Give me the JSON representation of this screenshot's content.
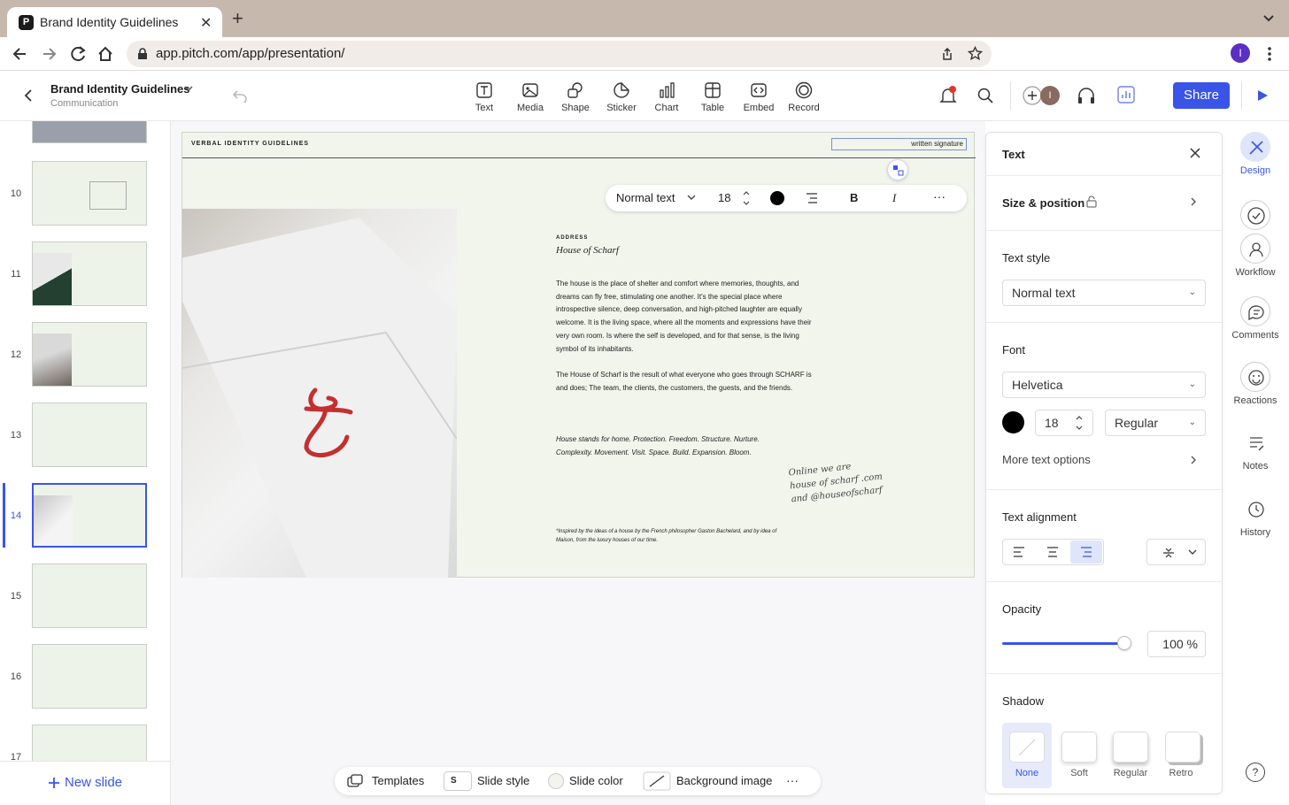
{
  "browser": {
    "tab_title": "Brand Identity Guidelines",
    "favicon_letter": "P",
    "url": "app.pitch.com/app/presentation/",
    "profile_initial": "I"
  },
  "header": {
    "doc_title": "Brand Identity Guidelines",
    "doc_subtitle": "Communication",
    "tools": [
      "Text",
      "Media",
      "Shape",
      "Sticker",
      "Chart",
      "Table",
      "Embed",
      "Record"
    ],
    "share_label": "Share",
    "avatar_initial": "I",
    "accent": "#3a54e8"
  },
  "slides": {
    "numbers": [
      "10",
      "11",
      "12",
      "13",
      "14",
      "15",
      "16",
      "17"
    ],
    "selected": "14",
    "new_slide_label": "New slide"
  },
  "slide": {
    "header": "VERBAL IDENTITY GUIDELINES",
    "signature_box": "written signature",
    "address_label": "ADDRESS",
    "address_name": "House of Scharf",
    "paragraph1": "The house is the place of shelter and comfort where memories, thoughts, and dreams can fly free, stimulating one another. It's the special place where introspective silence, deep conversation, and high-pitched laughter are equally welcome. It is the living space, where all the moments and expressions have their very own room. Is where the self is developed, and for that sense, is the living symbol of its inhabitants.",
    "paragraph2": "The House of Scharf is the result of what everyone who goes through SCHARF is and does; The team, the clients, the customers, the guests, and the friends.",
    "paragraph3": "House stands for home. Protection. Freedom. Structure. Nurture. Complexity. Movement. Visit. Space. Build. Expansion. Bloom.",
    "handwriting": [
      "Online we are",
      "house of scharf .com",
      "and @houseofscharf"
    ],
    "footnote": "*Inspired by the ideas of a house by the French philosopher Gaston Bachelard, and by idea of Maison, from the luxury houses of our time."
  },
  "format_bar": {
    "style": "Normal text",
    "size": "18",
    "bold": "B",
    "italic": "I",
    "more": "···"
  },
  "bottom_bar": {
    "templates": "Templates",
    "slide_style": "Slide style",
    "slide_style_icon": "S",
    "slide_color": "Slide color",
    "background_image": "Background image",
    "more": "···"
  },
  "panel": {
    "title": "Text",
    "size_position": "Size & position",
    "text_style_label": "Text style",
    "text_style_value": "Normal text",
    "font_label": "Font",
    "font_value": "Helvetica",
    "font_size": "18",
    "font_weight": "Regular",
    "more_text_options": "More text options",
    "alignment_label": "Text alignment",
    "opacity_label": "Opacity",
    "opacity_value": "100 %",
    "opacity_level": 1.0,
    "shadow_label": "Shadow",
    "shadow_options": [
      "None",
      "Soft",
      "Regular",
      "Retro"
    ],
    "shadow_selected": "None"
  },
  "rail": {
    "items": [
      "Design",
      "Workflow",
      "Comments",
      "Reactions",
      "Notes",
      "History"
    ],
    "help": "?"
  }
}
